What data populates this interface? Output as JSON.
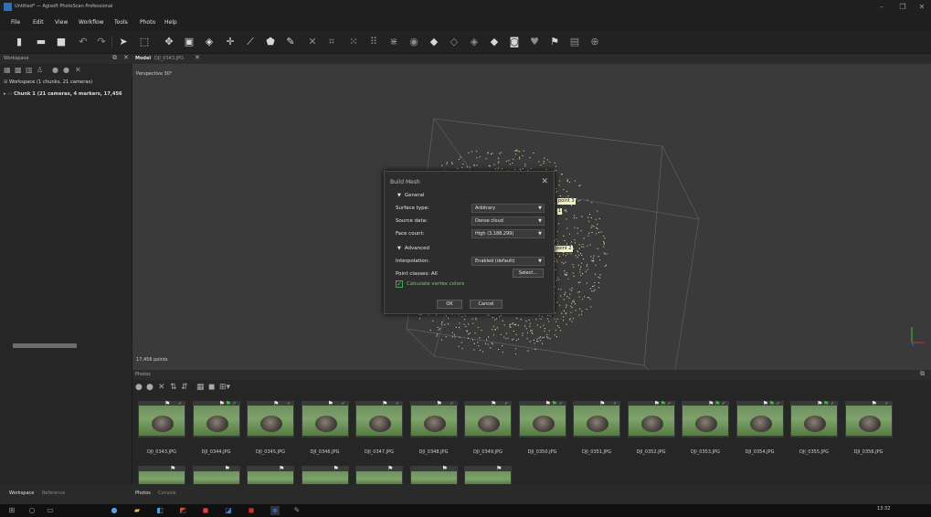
{
  "window": {
    "title": "Untitled* — Agisoft PhotoScan Professional",
    "controls": [
      "–",
      "❐",
      "✕"
    ]
  },
  "menu": [
    "File",
    "Edit",
    "View",
    "Workflow",
    "Tools",
    "Photo",
    "Help"
  ],
  "toolbar_icons": [
    "new-icon",
    "open-icon",
    "save-icon",
    "undo-icon",
    "redo-icon",
    "navigation-icon",
    "rectangle-selection-icon",
    "move-region-icon",
    "resize-region-icon",
    "rotate-region-icon",
    "move-object-icon",
    "ruler-icon",
    "polygon-icon",
    "draw-icon",
    "delete-icon",
    "crop-icon",
    "show-points-icon",
    "show-dense-cloud-icon",
    "show-mesh-icon",
    "show-texture-icon",
    "shaded-icon",
    "solid-icon",
    "wireframe-icon",
    "textured-icon",
    "show-cameras-icon",
    "show-shapes-icon",
    "show-markers-icon",
    "show-region-icon",
    "reset-view-icon"
  ],
  "workspace": {
    "panel_title": "Workspace",
    "root": "Workspace (1 chunks, 21 cameras)",
    "chunk": "Chunk 1 (21 cameras, 4 markers, 17,456",
    "tabs": [
      "Workspace",
      "Reference"
    ]
  },
  "model": {
    "tab_model": "Model",
    "tab_photo": "DJI_0343.JPG",
    "projection": "Perspective 30°",
    "points": "17,456 points",
    "markers": [
      "point 3",
      "1",
      "point 2"
    ]
  },
  "dialog": {
    "title": "Build Mesh",
    "general": "General",
    "advanced": "Advanced",
    "surface_type_label": "Surface type:",
    "surface_type": "Arbitrary",
    "source_data_label": "Source data:",
    "source_data": "Dense cloud",
    "face_count_label": "Face count:",
    "face_count": "High (3,188,299)",
    "interpolation_label": "Interpolation:",
    "interpolation": "Enabled (default)",
    "point_classes_label": "Point classes:",
    "point_classes": "All",
    "select_label": "Select...",
    "vertex_colors": "Calculate vertex colors",
    "ok": "OK",
    "cancel": "Cancel"
  },
  "photos": {
    "panel_title": "Photos",
    "tabs": [
      "Photos",
      "Console"
    ],
    "row1": [
      {
        "name": "DJI_0343.JPG",
        "green_flag": false
      },
      {
        "name": "DJI_0344.JPG",
        "green_flag": true
      },
      {
        "name": "DJI_0345.JPG",
        "green_flag": false
      },
      {
        "name": "DJI_0346.JPG",
        "green_flag": false
      },
      {
        "name": "DJI_0347.JPG",
        "green_flag": false
      },
      {
        "name": "DJI_0348.JPG",
        "green_flag": false
      },
      {
        "name": "DJI_0349.JPG",
        "green_flag": false
      },
      {
        "name": "DJI_0350.JPG",
        "green_flag": true
      },
      {
        "name": "DJI_0351.JPG",
        "green_flag": false
      },
      {
        "name": "DJI_0352.JPG",
        "green_flag": true
      },
      {
        "name": "DJI_0353.JPG",
        "green_flag": true
      },
      {
        "name": "DJI_0354.JPG",
        "green_flag": true
      },
      {
        "name": "DJI_0355.JPG",
        "green_flag": true
      },
      {
        "name": "DJI_0356.JPG",
        "green_flag": false
      }
    ]
  },
  "taskbar": {
    "clock": "13:32"
  }
}
